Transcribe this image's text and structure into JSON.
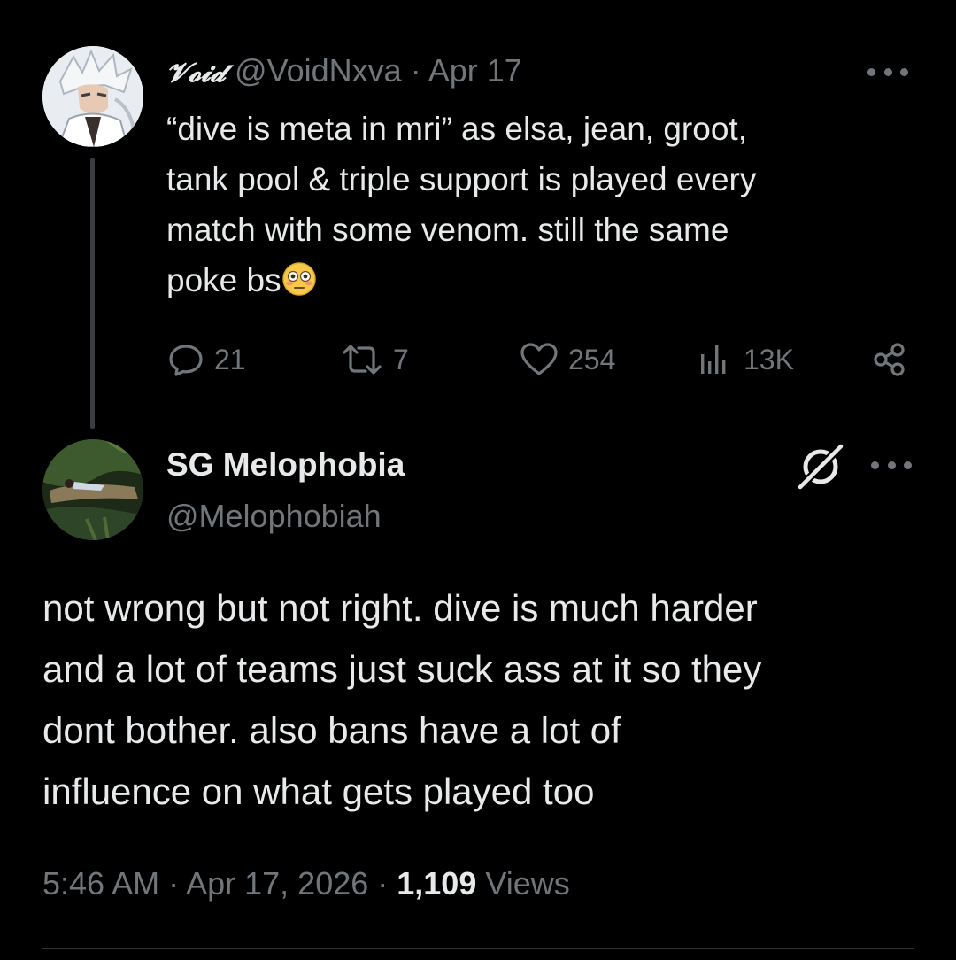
{
  "parent_tweet": {
    "author_name": "𝓥𝓸𝓲𝓭",
    "handle": "@VoidNxva",
    "separator": " · ",
    "date": "Apr 17",
    "body_lines": [
      "“dive is meta in mri” as elsa, jean, groot,",
      "tank pool & triple support is played every",
      "match with some venom. still the same",
      "poke bs"
    ],
    "emoji": "flushed-face",
    "actions": {
      "replies": "21",
      "reposts": "7",
      "likes": "254",
      "views": "13K"
    }
  },
  "reply_tweet": {
    "author_name": "SG Melophobia",
    "handle": "@Melophobiah",
    "body_lines": [
      "not wrong but not right. dive is much harder",
      "and a lot of teams just suck ass at it so they",
      "dont bother. also bans have a lot of",
      "influence on what gets played too"
    ],
    "time": "5:46 AM",
    "date": "Apr 17, 2026",
    "separator": " · ",
    "views_count": "1,109",
    "views_label": " Views"
  },
  "icons": {
    "reply": "speech-bubble-icon",
    "repost": "repost-arrows-icon",
    "like": "heart-icon",
    "views": "bar-chart-icon",
    "share": "share-nodes-icon",
    "more": "ellipsis-icon",
    "grok": "grok-icon"
  },
  "colors": {
    "background": "#000000",
    "text_primary": "#e7e9ea",
    "text_secondary": "#71767b",
    "thread_line": "#3a3d41"
  }
}
